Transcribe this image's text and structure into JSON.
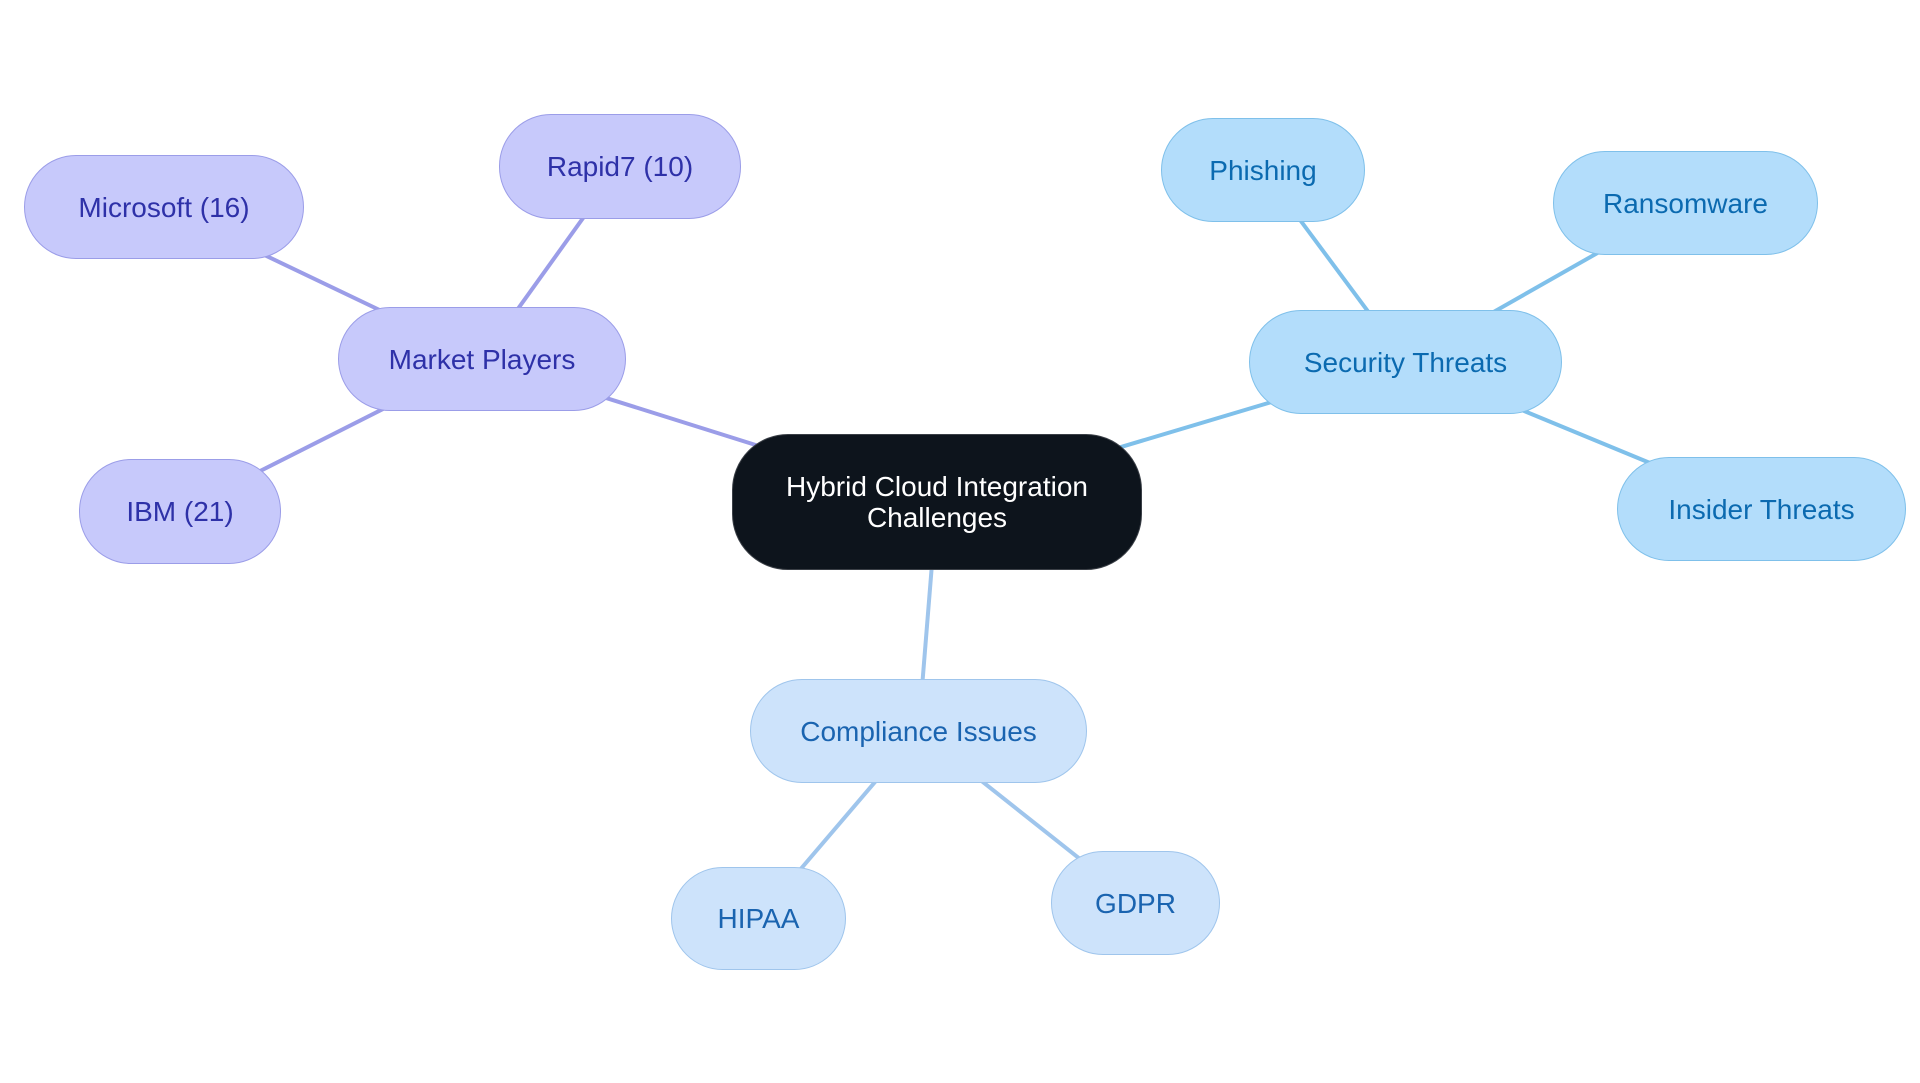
{
  "diagram": {
    "type": "mind-map",
    "root": {
      "id": "root",
      "label": "Hybrid Cloud Integration Challenges",
      "lines": [
        "Hybrid Cloud Integration",
        "Challenges"
      ]
    },
    "branches": [
      {
        "id": "market",
        "label": "Market Players",
        "color_scheme": "purple",
        "children": [
          {
            "id": "microsoft",
            "label": "Microsoft (16)"
          },
          {
            "id": "rapid7",
            "label": "Rapid7 (10)"
          },
          {
            "id": "ibm",
            "label": "IBM (21)"
          }
        ]
      },
      {
        "id": "security",
        "label": "Security Threats",
        "color_scheme": "sky",
        "children": [
          {
            "id": "phishing",
            "label": "Phishing"
          },
          {
            "id": "ransom",
            "label": "Ransomware"
          },
          {
            "id": "insider",
            "label": "Insider Threats"
          }
        ]
      },
      {
        "id": "compliance",
        "label": "Compliance Issues",
        "color_scheme": "pale",
        "children": [
          {
            "id": "hipaa",
            "label": "HIPAA"
          },
          {
            "id": "gdpr",
            "label": "GDPR"
          }
        ]
      }
    ]
  },
  "colors": {
    "root_fill": "#0d141c",
    "root_text": "#ffffff",
    "purple_fill": "#c7c9fb",
    "purple_stroke": "#9b9de8",
    "purple_text": "#2e31a8",
    "sky_fill": "#b3ddfb",
    "sky_stroke": "#7fc0ea",
    "sky_text": "#0b6ab0",
    "pale_fill": "#cde3fb",
    "pale_stroke": "#9fc5ec",
    "pale_text": "#1a64b0",
    "background": "#ffffff"
  }
}
